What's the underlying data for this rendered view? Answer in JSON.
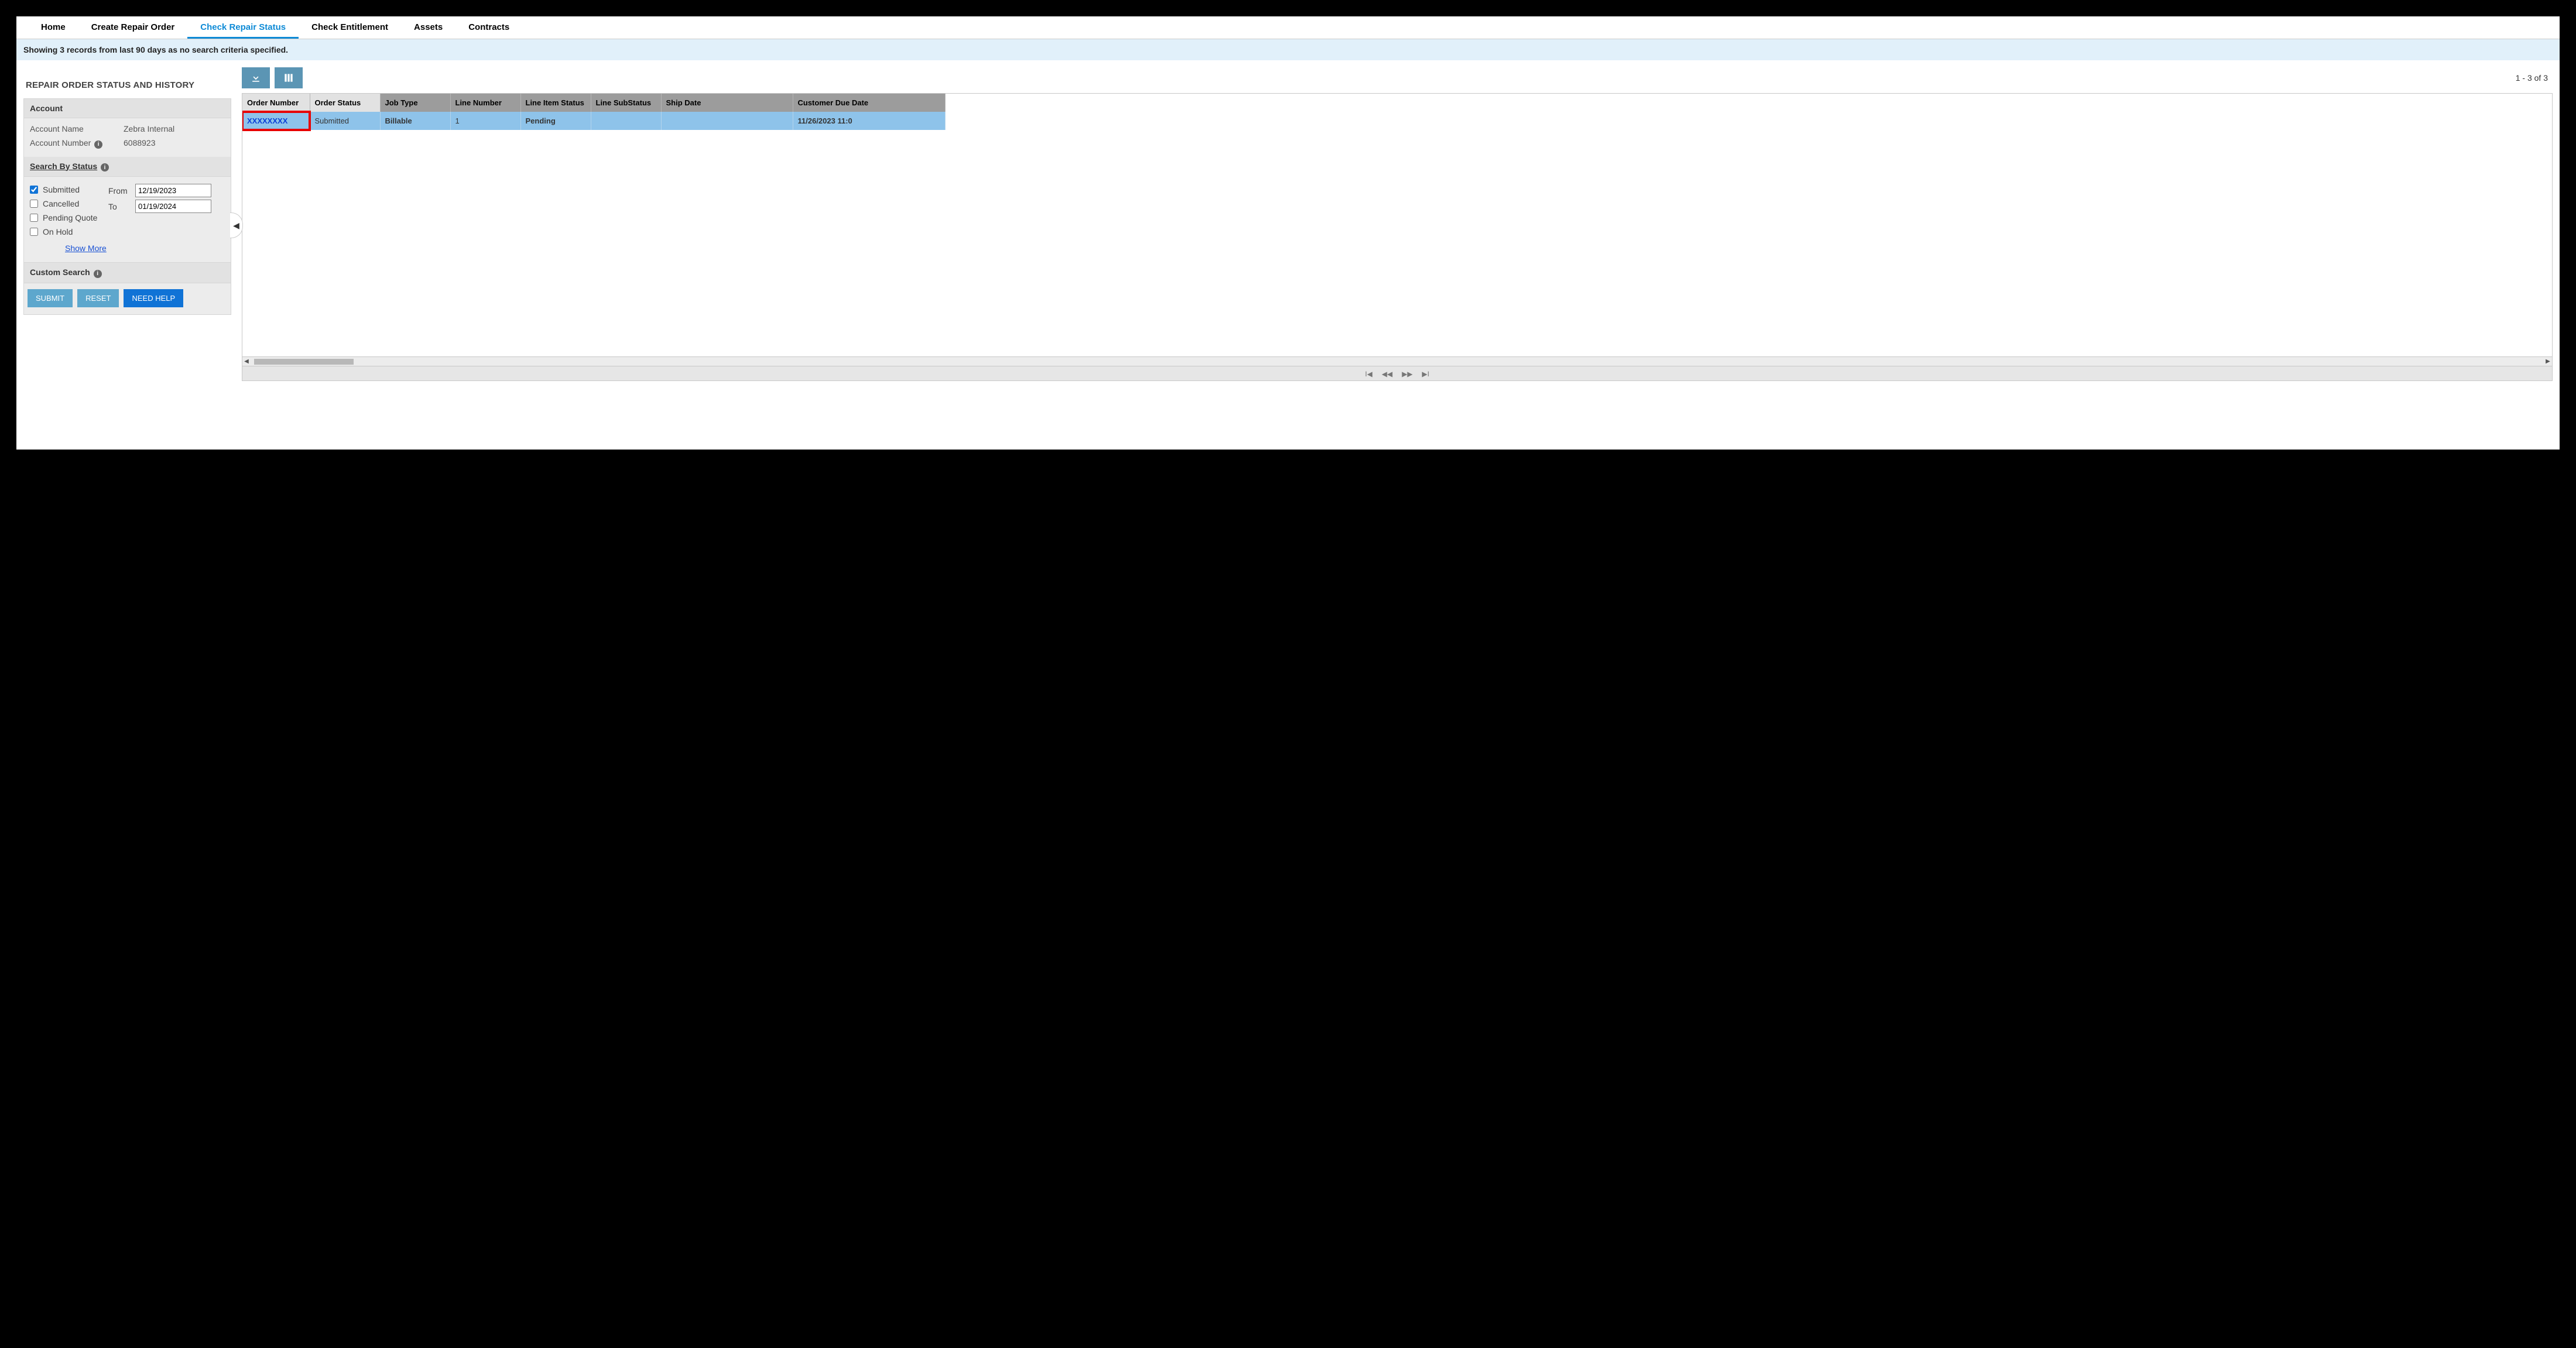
{
  "tabs": [
    {
      "label": "Home",
      "active": false
    },
    {
      "label": "Create Repair Order",
      "active": false
    },
    {
      "label": "Check Repair Status",
      "active": true
    },
    {
      "label": "Check Entitlement",
      "active": false
    },
    {
      "label": "Assets",
      "active": false
    },
    {
      "label": "Contracts",
      "active": false
    }
  ],
  "info_bar": "Showing 3 records from last 90 days as no search criteria specified.",
  "page_title": "REPAIR ORDER STATUS AND HISTORY",
  "record_count": "1 - 3 of 3",
  "account": {
    "header": "Account",
    "name_label": "Account Name",
    "name_value": "Zebra Internal",
    "number_label": "Account Number",
    "number_value": "6088923"
  },
  "search_by_status": {
    "header": "Search By Status",
    "checks": [
      {
        "label": "Submitted",
        "checked": true
      },
      {
        "label": "Cancelled",
        "checked": false
      },
      {
        "label": "Pending Quote",
        "checked": false
      },
      {
        "label": "On Hold",
        "checked": false
      }
    ],
    "from_label": "From",
    "from_value": "12/19/2023",
    "to_label": "To",
    "to_value": "01/19/2024",
    "show_more": "Show More"
  },
  "custom_search": {
    "header": "Custom Search"
  },
  "buttons": {
    "submit": "SUBMIT",
    "reset": "RESET",
    "help": "NEED HELP"
  },
  "grid": {
    "columns": [
      "Order Number",
      "Order Status",
      "Job Type",
      "Line Number",
      "Line Item Status",
      "Line SubStatus",
      "Ship Date",
      "Customer Due Date"
    ],
    "rows": [
      {
        "order_number": "XXXXXXXX",
        "order_status": "Submitted",
        "job_type": "Billable",
        "line_number": "1",
        "line_item_status": "Pending",
        "line_substatus": "",
        "ship_date": "",
        "customer_due_date": "11/26/2023 11:0",
        "highlighted": true
      }
    ]
  }
}
